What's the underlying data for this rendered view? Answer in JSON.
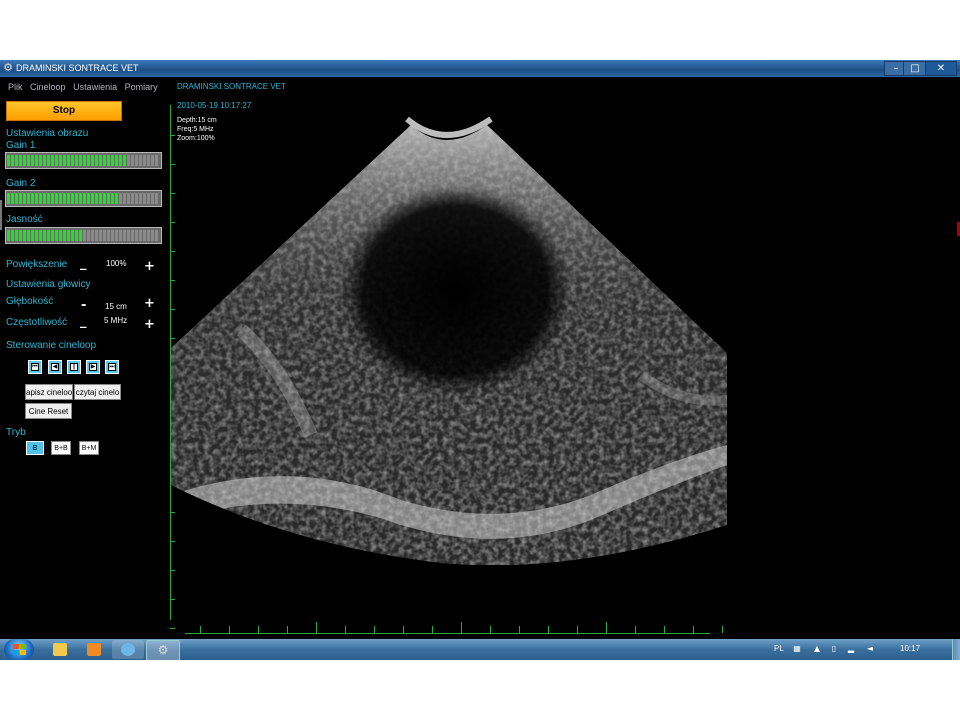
{
  "window": {
    "title": "DRAMINSKI SONTRACE VET",
    "minimize_icon": "minimize-icon",
    "maximize_icon": "maximize-icon",
    "close_icon": "close-icon",
    "min_glyph": "–",
    "max_glyph": "□",
    "close_glyph": "✕"
  },
  "menu": [
    "Plik",
    "Cineloop",
    "Ustawienia",
    "Pomiary"
  ],
  "stop_button": "Stop",
  "image_settings": {
    "heading": "Ustawienia obrazu",
    "gain1": {
      "label": "Gain 1",
      "level": 0.8
    },
    "gain2": {
      "label": "Gain 2",
      "level": 0.73
    },
    "brightness": {
      "label": "Jasność",
      "level": 0.5
    }
  },
  "zoom": {
    "label": "Powiększenie",
    "value": "100%",
    "minus": "_",
    "plus": "+"
  },
  "probe_settings": {
    "heading": "Ustawienia głowicy",
    "depth": {
      "label": "Głębokość",
      "value": "15 cm",
      "minus": "-",
      "plus": "+"
    },
    "frequency": {
      "label": "Częstotliwość",
      "value": "5 MHz",
      "minus": "_",
      "plus": "+"
    }
  },
  "cineloop": {
    "heading": "Sterowanie cineloop",
    "controls": [
      "first-frame-icon",
      "previous-frame-icon",
      "pause-icon",
      "next-frame-icon",
      "last-frame-icon"
    ],
    "save_button": "apisz cineloo",
    "load_button": "czytaj cinelo",
    "reset_button": "Cine Reset"
  },
  "mode": {
    "heading": "Tryb",
    "options": [
      "B",
      "B+B",
      "B+M"
    ],
    "active": "B"
  },
  "image": {
    "app_title": "DRAMINSKI SONTRACE VET",
    "datetime": "2010-05-19 10:17:27",
    "depth": "Depth:15 cm",
    "freq": "Freq:5 MHz",
    "zoom": "Zoom:100%"
  },
  "taskbar": {
    "items": [
      "windows-explorer-icon",
      "media-player-icon",
      "browser-icon",
      "sontrace-app-icon"
    ],
    "language": "PL",
    "clock": "10:17"
  },
  "colors": {
    "accent": "#2fb4d0",
    "stop": "#ff9d00",
    "bar_on": "#22e02a",
    "ruler": "#2ca93a"
  }
}
